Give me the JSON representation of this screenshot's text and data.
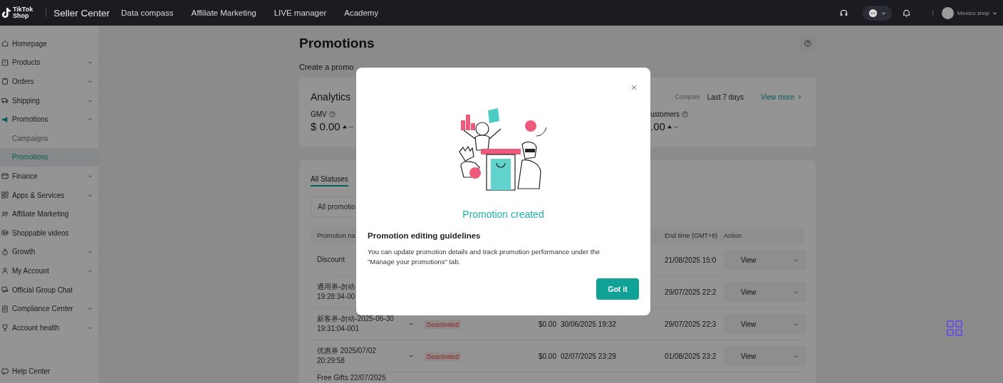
{
  "top_bar": {
    "logo": {
      "line_1": "TikTok",
      "line_2": "Shop"
    },
    "product": "Seller Center",
    "nav": [
      "Data compass",
      "Affiliate Marketing",
      "LIVE manager",
      "Academy"
    ],
    "account": "Mexico shop"
  },
  "sidebar": {
    "items": [
      {
        "label": "Homepage",
        "kind": "link"
      },
      {
        "label": "Products",
        "kind": "menu",
        "expanded": false
      },
      {
        "label": "Orders",
        "kind": "menu",
        "expanded": false
      },
      {
        "label": "Shipping",
        "kind": "menu",
        "expanded": false
      },
      {
        "label": "Promotions",
        "kind": "menu",
        "expanded": true,
        "children": [
          {
            "label": "Campaigns",
            "selected": false
          },
          {
            "label": "Promotions",
            "selected": true
          }
        ]
      },
      {
        "label": "Finance",
        "kind": "menu",
        "expanded": false
      },
      {
        "label": "Apps & Services",
        "kind": "menu",
        "expanded": false
      },
      {
        "label": "Affiliate Marketing",
        "kind": "link"
      },
      {
        "label": "Shoppable videos",
        "kind": "link"
      },
      {
        "label": "Growth",
        "kind": "menu",
        "expanded": false
      },
      {
        "label": "My Account",
        "kind": "menu",
        "expanded": false
      },
      {
        "label": "Official Group Chat",
        "kind": "link"
      },
      {
        "label": "Compliance Center",
        "kind": "menu",
        "expanded": false
      },
      {
        "label": "Account health",
        "kind": "menu",
        "expanded": false
      }
    ],
    "footer": "Help Center"
  },
  "page": {
    "title": "Promotions",
    "tabs": [
      "Create a promo"
    ]
  },
  "analytics": {
    "title": "Analytics",
    "compare_label": "Compare",
    "period": "Last 7 days",
    "view_more": "View more",
    "metrics": [
      {
        "label": "GMV",
        "value": "$ 0.00",
        "change": "--"
      },
      {
        "label": "ustomers",
        "value": ".00",
        "change": "--"
      }
    ]
  },
  "promotions_table": {
    "tabs": [
      {
        "label": "All Statuses",
        "selected": true
      }
    ],
    "filter": "All promotio",
    "columns": {
      "name": "Promotion na",
      "end_time": "End time (GMT+8)",
      "action": "Action"
    },
    "rows": [
      {
        "name": [
          "Discount"
        ],
        "end": "21/08/2025 15:0",
        "action": "View"
      },
      {
        "name": [
          "通用券-勿动",
          "19:28:34-00"
        ],
        "end": "29/07/2025 22:2",
        "action": "View"
      },
      {
        "name": [
          "新客券-勿动-2025-06-30",
          "19:31:04-001"
        ],
        "expanded": false,
        "status": "Deactivated",
        "amount": "$0.00",
        "start": "30/06/2025 19:32",
        "end": "29/07/2025 22:3",
        "action": "View"
      },
      {
        "name": [
          "优惠券 2025/07/02",
          "20:29:58"
        ],
        "expanded": false,
        "status": "Deactivated",
        "amount": "$0.00",
        "start": "02/07/2025 23:29",
        "end": "01/08/2025 23:2",
        "action": "View"
      },
      {
        "name": [
          "Free Gifts 22/07/2025"
        ]
      }
    ]
  },
  "modal": {
    "title": "Promotion created",
    "heading": "Promotion editing guidelines",
    "body": "You can update promotion details and track promotion performance under the \"Manage your promotions\" tab.",
    "button": "Got it"
  }
}
